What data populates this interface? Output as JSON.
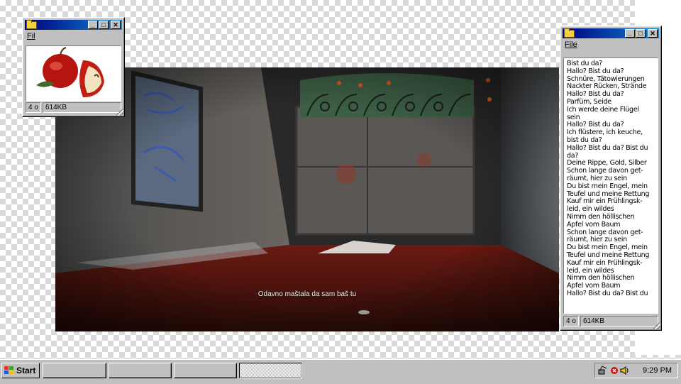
{
  "video": {
    "subtitle": "Odavno maštala da sam baš tu"
  },
  "window_left": {
    "menu_label": "Fil",
    "status_count": "4 o",
    "status_size": "614KB",
    "content_image": "apples"
  },
  "window_right": {
    "menu_label": "File",
    "status_count": "4 o",
    "status_size": "614KB",
    "lines": [
      "Bist du da?",
      "Hallo? Bist du da?",
      "Schnüre, Tätowierungen",
      "Nackter Rücken, Strände",
      "Hallo? Bist du da?",
      "Parfüm, Seide",
      "Ich werde deine Flügel",
      "sein",
      "Hallo? Bist du da?",
      "Ich flüstere, ich keuche,",
      "bist du da?",
      "Hallo? Bist du da? Bist du",
      "da?",
      "Deine Rippe, Gold, Silber",
      "Schon lange davon get-",
      "räumt, hier zu sein",
      "Du bist mein Engel, mein",
      "Teufel und meine Rettung",
      "Kauf mir ein Frühlingsk-",
      "leid, ein wildes",
      "Nimm den höllischen",
      "Apfel vom Baum",
      "Schon lange davon get-",
      "räumt, hier zu sein",
      "Du bist mein Engel, mein",
      "Teufel und meine Rettung",
      "Kauf mir ein Frühlingsk-",
      "leid, ein wildes",
      "Nimm den höllischen",
      "Apfel vom Baum",
      "Hallo? Bist du da? Bist du"
    ]
  },
  "titlebar_buttons": [
    "_",
    "□",
    "✕"
  ],
  "taskbar": {
    "start_label": "Start",
    "clock": "9:29 PM",
    "tasks": [
      "",
      "",
      "",
      ""
    ]
  },
  "colors": {
    "titlebar_start": "#000080",
    "titlebar_end": "#1084d0",
    "face": "#c0c0c0"
  }
}
